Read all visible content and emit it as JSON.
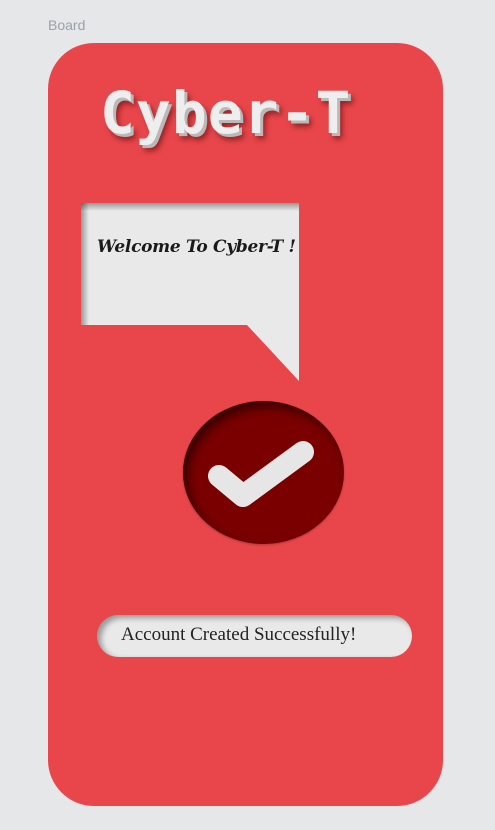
{
  "canvas": {
    "board_label": "Board"
  },
  "app": {
    "logo": "Cyber-T",
    "welcome_message": "Welcome To Cyber-T !",
    "success_icon": "checkmark-icon",
    "status_message": "Account Created Successfully!"
  },
  "colors": {
    "page_background": "#e6e7e9",
    "phone_background": "#e8464a",
    "check_circle": "#7a0000",
    "light_surface": "#e9e9e9"
  }
}
